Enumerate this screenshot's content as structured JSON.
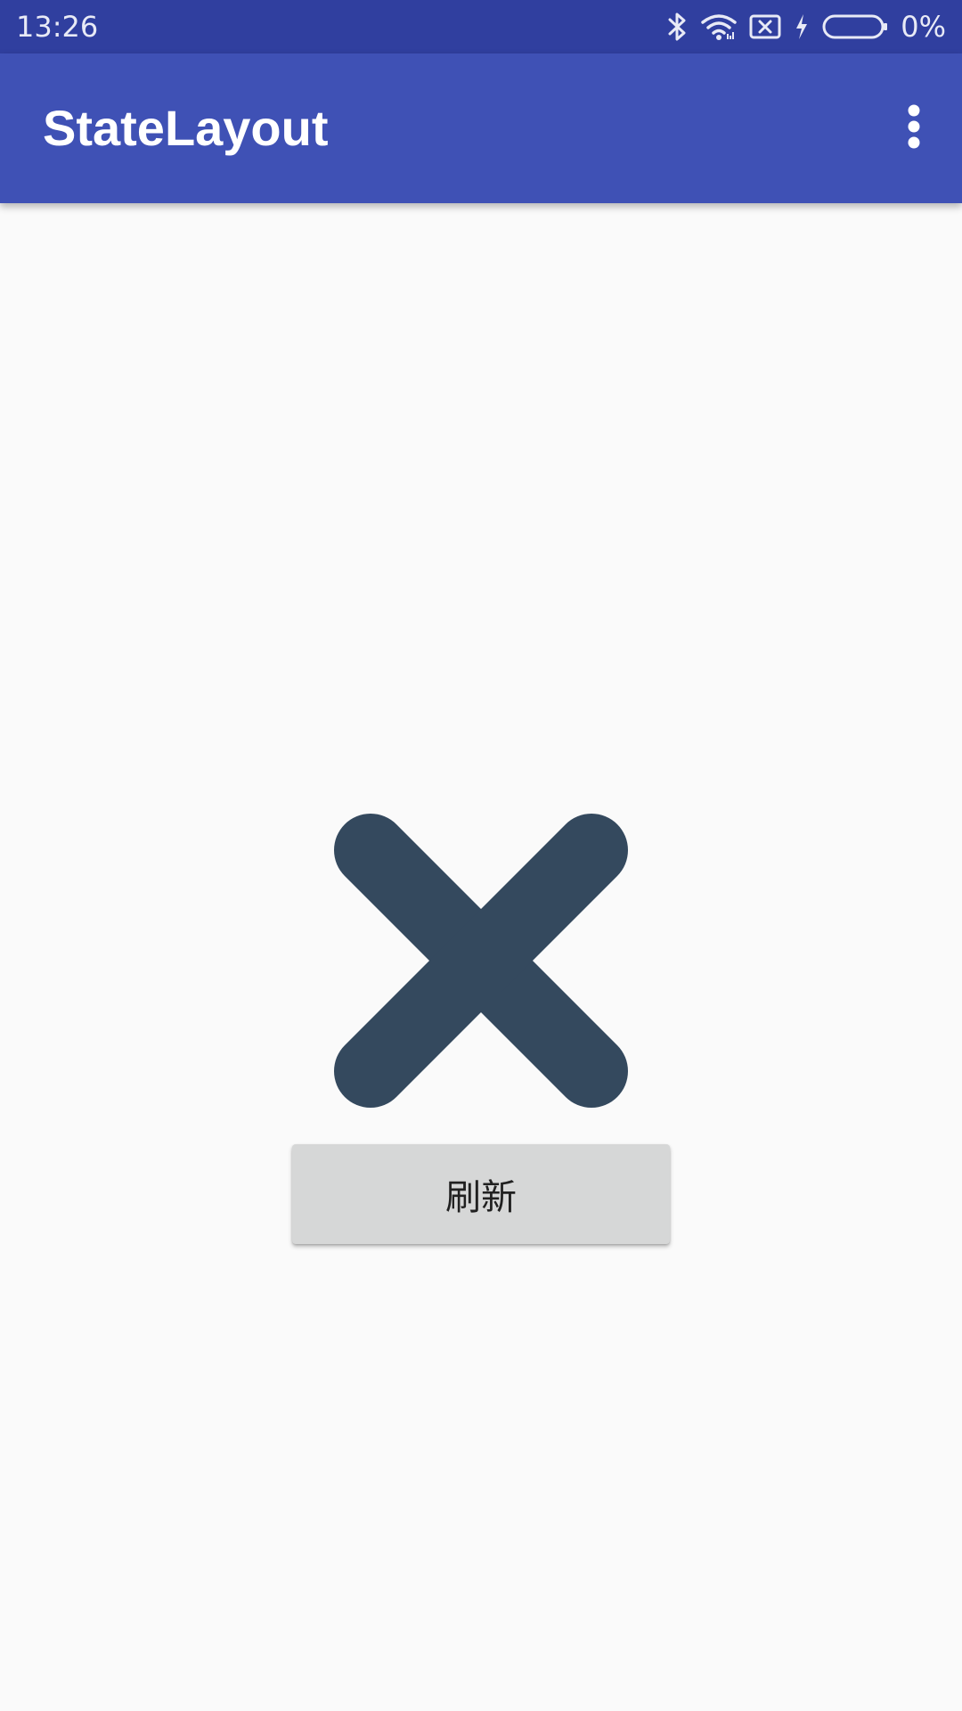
{
  "status_bar": {
    "time": "13:26",
    "battery_percent": "0%",
    "icons": [
      "bluetooth-icon",
      "wifi-icon",
      "sim-no-signal-icon",
      "charging-bolt-icon",
      "battery-icon"
    ],
    "background": "#303f9f"
  },
  "app_bar": {
    "title": "StateLayout",
    "menu_icon": "more-vertical-icon",
    "background": "#3f51b5"
  },
  "content": {
    "error_icon": "close-x-icon",
    "error_icon_color": "#34495e",
    "refresh_label": "刷新",
    "background": "#fafafa"
  }
}
